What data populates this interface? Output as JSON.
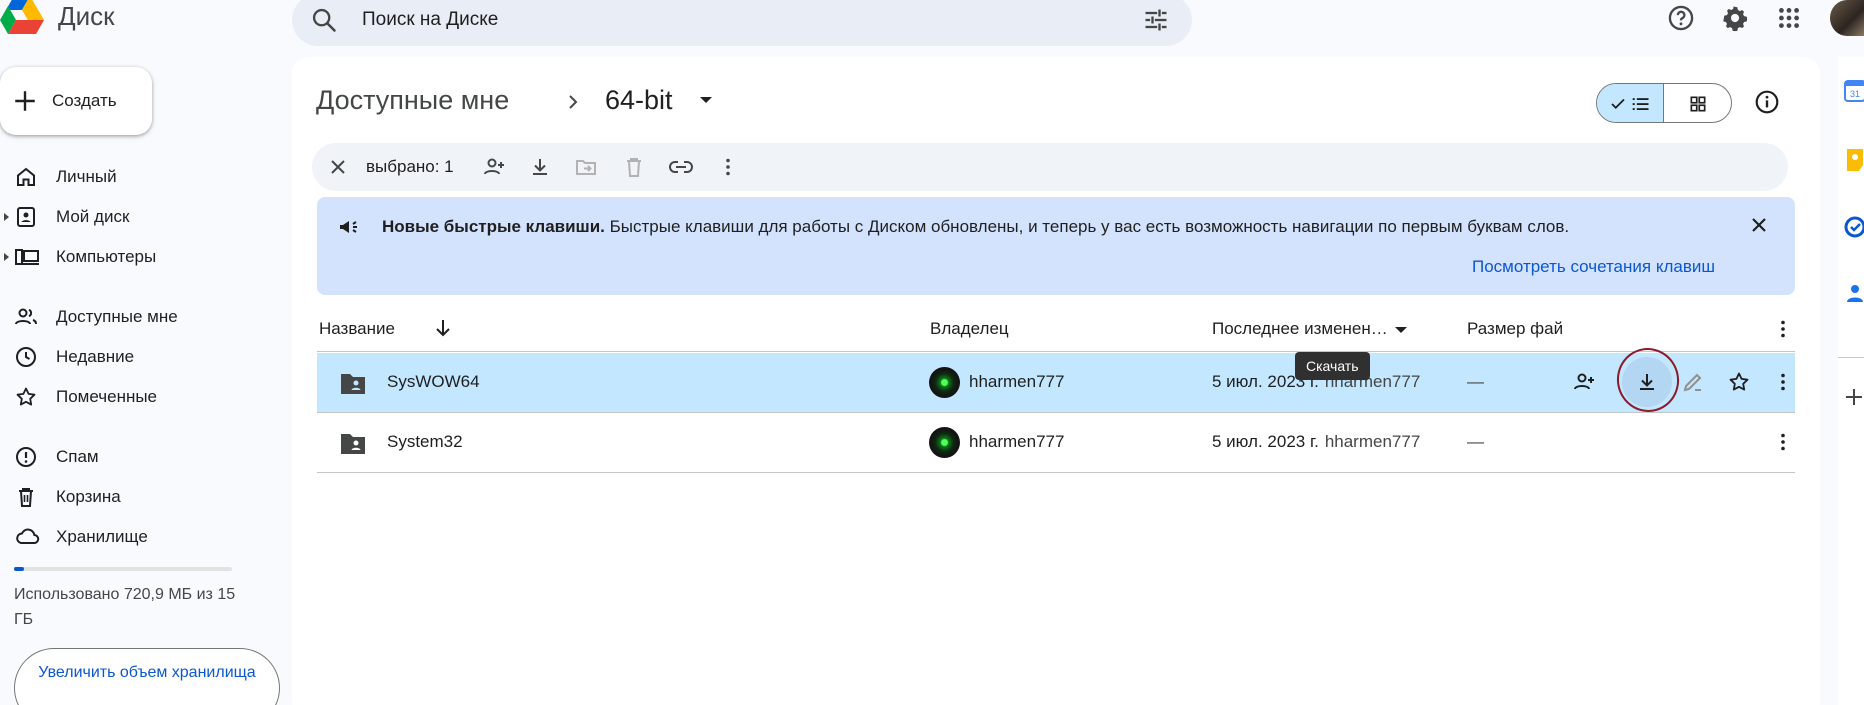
{
  "app": {
    "title": "Диск"
  },
  "search": {
    "placeholder": "Поиск на Диске"
  },
  "create_button": {
    "label": "Создать"
  },
  "sidebar": {
    "items": [
      {
        "label": "Личный",
        "icon": "home-icon"
      },
      {
        "label": "Мой диск",
        "icon": "my-drive-icon"
      },
      {
        "label": "Компьютеры",
        "icon": "computers-icon"
      },
      {
        "label": "Доступные мне",
        "icon": "shared-with-me-icon"
      },
      {
        "label": "Недавние",
        "icon": "clock-icon"
      },
      {
        "label": "Помеченные",
        "icon": "star-icon"
      },
      {
        "label": "Спам",
        "icon": "spam-icon"
      },
      {
        "label": "Корзина",
        "icon": "trash-icon"
      },
      {
        "label": "Хранилище",
        "icon": "cloud-icon"
      }
    ],
    "storage": {
      "used_text": "Использовано 720,9 МБ из 15 ГБ",
      "used_fraction": 0.047
    },
    "upgrade_button": "Увеличить объем хранилища"
  },
  "breadcrumb": {
    "root": "Доступные мне",
    "current": "64-bit"
  },
  "selection_bar": {
    "count_label": "выбрано: 1"
  },
  "banner": {
    "title": "Новые быстрые клавиши.",
    "text": "Быстрые клавиши для работы с Диском обновлены, и теперь у вас есть возможность навигации по первым буквам слов.",
    "link": "Посмотреть сочетания клавиш"
  },
  "table": {
    "headers": {
      "name": "Название",
      "owner": "Владелец",
      "modified": "Последнее изменен…",
      "size": "Размер фай"
    },
    "rows": [
      {
        "name": "SysWOW64",
        "owner": "hharmen777",
        "modified_date": "5 июл. 2023 г.",
        "modified_by": "hharmen777",
        "size": "—",
        "selected": true
      },
      {
        "name": "System32",
        "owner": "hharmen777",
        "modified_date": "5 июл. 2023 г.",
        "modified_by": "hharmen777",
        "size": "—",
        "selected": false
      }
    ]
  },
  "tooltip": {
    "text": "Скачать"
  },
  "colors": {
    "accent": "#0b57d0",
    "selected_row": "#c2e7ff",
    "banner_bg": "#d3e3fd",
    "annotation": "#8b1a2c"
  }
}
